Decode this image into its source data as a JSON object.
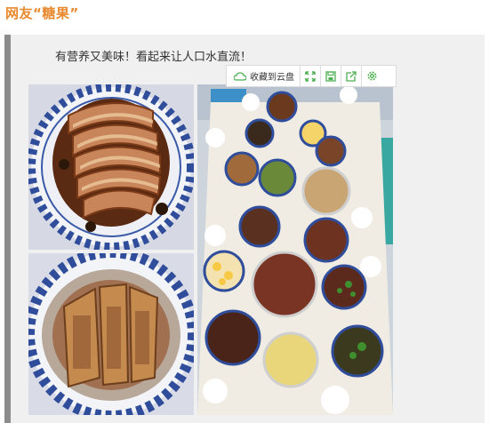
{
  "header": {
    "title": "网友“糖果”"
  },
  "post": {
    "caption": "有营养又美味！看起来让人口水直流！"
  },
  "toolbar": {
    "save_cloud_label": "收藏到云盘",
    "icons": [
      "cloud-icon",
      "expand-icon",
      "save-icon",
      "share-icon",
      "settings-icon"
    ]
  },
  "images": [
    {
      "name": "braised-pork-top",
      "depicts": "braised pork belly slices on blue-white plate"
    },
    {
      "name": "braised-pork-bottom",
      "depicts": "braised pork in brown sauce on blue-white plate"
    },
    {
      "name": "feast-table",
      "depicts": "table with many dishes"
    }
  ],
  "colors": {
    "title": "#e8892e",
    "accent_green": "#4caf50",
    "quote_bg": "#f0f0f0",
    "quote_bar": "#8c8c8c"
  }
}
